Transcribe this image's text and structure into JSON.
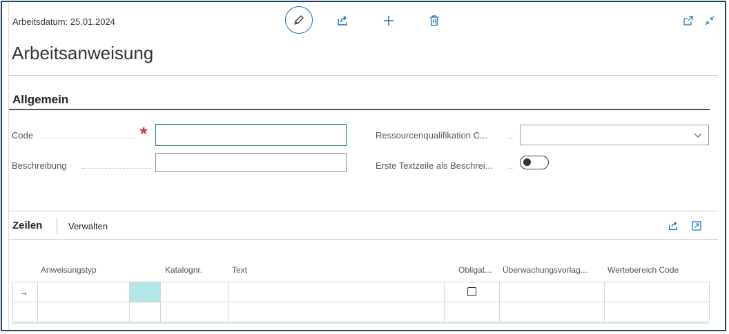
{
  "header": {
    "work_date": "Arbeitsdatum: 25.01.2024",
    "page_title": "Arbeitsanweisung"
  },
  "toolbar": {
    "edit_icon": "pencil-icon",
    "share_icon": "share-icon",
    "add_icon": "plus-icon",
    "delete_icon": "trash-icon",
    "popout_icon": "open-in-new-window-icon",
    "collapse_icon": "collapse-icon"
  },
  "general": {
    "title": "Allgemein",
    "code_label": "Code",
    "code_value": "",
    "required_mark": "*",
    "description_label": "Beschreibung",
    "description_value": "",
    "resource_qual_label": "Ressourcenqualifikation C...",
    "resource_qual_value": "",
    "first_line_label": "Erste Textzeile als Beschrei...",
    "first_line_value": false
  },
  "lines": {
    "tabs": [
      "Zeilen",
      "Verwalten"
    ],
    "columns": [
      "Anweisungstyp",
      "Katalognr.",
      "Text",
      "Obligat...",
      "Überwachungsvorlag...",
      "Wertebereich Code"
    ],
    "row_indicator": "→",
    "rows": [
      {
        "anweisungstyp": "",
        "katalognr": "",
        "text": "",
        "obligatorisch": false,
        "ueberwachungsvorlage": "",
        "wertebereich_code": ""
      },
      {
        "anweisungstyp": "",
        "katalognr": "",
        "text": "",
        "obligatorisch": null,
        "ueberwachungsvorlage": "",
        "wertebereich_code": ""
      }
    ]
  },
  "colors": {
    "accent": "#0f6cbd",
    "required": "#d13438",
    "selected_cell": "#b4e5e8",
    "frame": "#1f3f6a"
  }
}
